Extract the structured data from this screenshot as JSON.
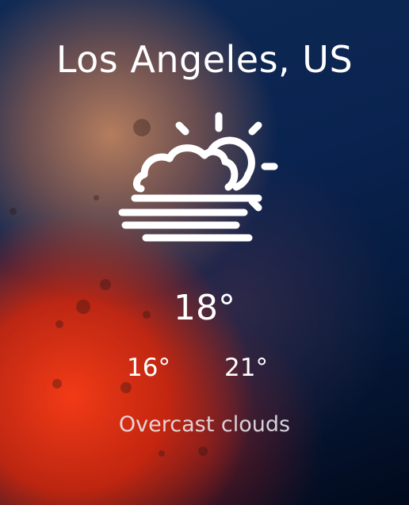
{
  "weather": {
    "location": "Los Angeles, US",
    "icon": "partly-cloudy-with-fog-icon",
    "temperature": "18°",
    "temp_min": "16°",
    "temp_max": "21°",
    "description": "Overcast clouds"
  }
}
